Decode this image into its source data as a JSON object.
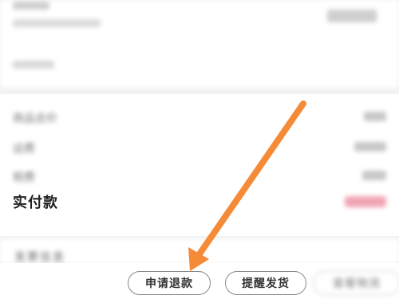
{
  "order_header": {
    "title_blurred": "",
    "subtitle_blurred": ""
  },
  "price_details": {
    "rows": [
      {
        "label": "商品总价"
      },
      {
        "label": "运费"
      },
      {
        "label": "税费"
      }
    ],
    "paid_label": "实付款"
  },
  "invoice": {
    "title": "发票信息"
  },
  "actions": {
    "refund_label": "申请退款",
    "remind_label": "提醒发货",
    "logistics_label": "查看物流"
  },
  "colors": {
    "arrow": "#f58a37",
    "paid_value": "#f0a5b4"
  }
}
